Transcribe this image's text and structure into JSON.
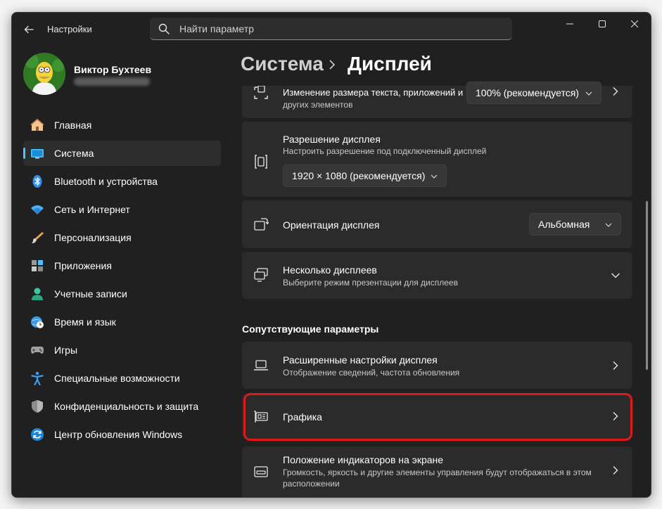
{
  "titlebar": {
    "app_title": "Настройки",
    "search_placeholder": "Найти параметр",
    "back_icon": "arrow-left-icon",
    "window_controls": [
      "minimize-icon",
      "maximize-icon",
      "close-icon"
    ]
  },
  "profile": {
    "name": "Виктор Бухтеев",
    "avatar_icon": "user-avatar"
  },
  "sidebar": {
    "items": [
      {
        "label": "Главная",
        "icon": "home-icon"
      },
      {
        "label": "Система",
        "icon": "monitor-icon",
        "active": true
      },
      {
        "label": "Bluetooth и устройства",
        "icon": "bluetooth-icon"
      },
      {
        "label": "Сеть и Интернет",
        "icon": "wifi-icon"
      },
      {
        "label": "Персонализация",
        "icon": "brush-icon"
      },
      {
        "label": "Приложения",
        "icon": "apps-icon"
      },
      {
        "label": "Учетные записи",
        "icon": "person-icon"
      },
      {
        "label": "Время и язык",
        "icon": "globe-clock-icon"
      },
      {
        "label": "Игры",
        "icon": "gamepad-icon"
      },
      {
        "label": "Специальные возможности",
        "icon": "accessibility-icon"
      },
      {
        "label": "Конфиденциальность и защита",
        "icon": "shield-icon"
      },
      {
        "label": "Центр обновления Windows",
        "icon": "refresh-icon"
      }
    ]
  },
  "header": {
    "crumb_parent": "Система",
    "crumb_current": "Дисплей"
  },
  "content": {
    "scale": {
      "title": "Изменение размера текста, приложений и",
      "subtitle": "других элементов",
      "value": "100% (рекомендуется)"
    },
    "resolution": {
      "title": "Разрешение дисплея",
      "subtitle": "Настроить разрешение под подключенный дисплей",
      "value": "1920 × 1080 (рекомендуется)"
    },
    "orientation": {
      "title": "Ориентация дисплея",
      "value": "Альбомная"
    },
    "multiple": {
      "title": "Несколько дисплеев",
      "subtitle": "Выберите режим презентации для дисплеев"
    },
    "related_title": "Сопутствующие параметры",
    "advanced": {
      "title": "Расширенные настройки дисплея",
      "subtitle": "Отображение сведений, частота обновления"
    },
    "graphics": {
      "title": "Графика"
    },
    "indicators": {
      "title": "Положение индикаторов на экране",
      "subtitle_line1": "Громкость, яркость и другие элементы управления будут отображаться в этом",
      "subtitle_line2": "расположении"
    }
  },
  "colors": {
    "accent": "#4cc2ff",
    "highlight": "#e01818",
    "background": "#202020",
    "card": "#2b2b2b"
  }
}
